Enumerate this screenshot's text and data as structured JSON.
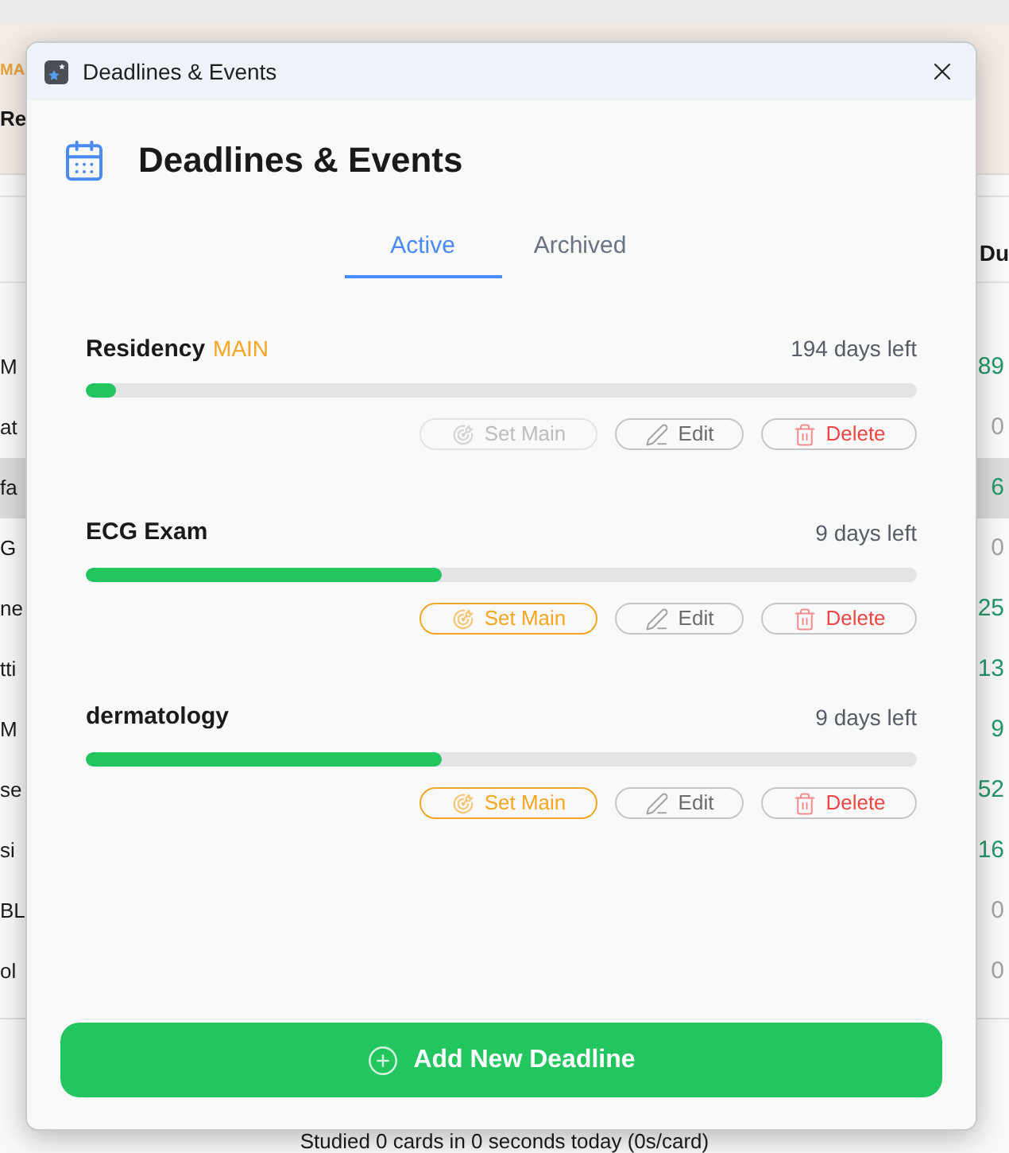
{
  "background": {
    "header_tag": "MA",
    "header_title": "Re",
    "column_header": "Du",
    "rows": [
      {
        "name": "M",
        "due": "89",
        "color": "#25966a",
        "selected": false
      },
      {
        "name": "at",
        "due": "0",
        "color": "#a3a3a3",
        "selected": false
      },
      {
        "name": "fa",
        "due": "6",
        "color": "#25966a",
        "selected": true
      },
      {
        "name": "G",
        "due": "0",
        "color": "#a3a3a3",
        "selected": false
      },
      {
        "name": "ne",
        "due": "25",
        "color": "#25966a",
        "selected": false
      },
      {
        "name": "tti",
        "due": "13",
        "color": "#25966a",
        "selected": false
      },
      {
        "name": "M",
        "due": "9",
        "color": "#25966a",
        "selected": false
      },
      {
        "name": "se",
        "due": "52",
        "color": "#25966a",
        "selected": false
      },
      {
        "name": "si",
        "due": "16",
        "color": "#25966a",
        "selected": false
      },
      {
        "name": "BL",
        "due": "0",
        "color": "#a3a3a3",
        "selected": false
      },
      {
        "name": "ol",
        "due": "0",
        "color": "#a3a3a3",
        "selected": false
      }
    ],
    "footer": "Studied 0 cards in 0 seconds today (0s/card)"
  },
  "dialog": {
    "window_title": "Deadlines & Events",
    "heading": "Deadlines & Events",
    "tabs": [
      {
        "label": "Active",
        "selected": true
      },
      {
        "label": "Archived",
        "selected": false
      }
    ],
    "deadlines": [
      {
        "title": "Residency",
        "tag": "MAIN",
        "days_left": "194 days left",
        "level": 0.036,
        "actions": [
          {
            "kind": "set_main",
            "label": "Set Main",
            "disabled": true
          },
          {
            "kind": "edit",
            "label": "Edit",
            "disabled": false
          },
          {
            "kind": "delete",
            "label": "Delete",
            "disabled": false
          }
        ]
      },
      {
        "title": "ECG Exam",
        "days_left": "9 days left",
        "level": 0.428,
        "actions": [
          {
            "kind": "set_main",
            "label": "Set Main",
            "disabled": false
          },
          {
            "kind": "edit",
            "label": "Edit",
            "disabled": false
          },
          {
            "kind": "delete",
            "label": "Delete",
            "disabled": false
          }
        ]
      },
      {
        "title": "dermatology",
        "days_left": "9 days left",
        "level": 0.428,
        "actions": [
          {
            "kind": "set_main",
            "label": "Set Main",
            "disabled": false
          },
          {
            "kind": "edit",
            "label": "Edit",
            "disabled": false
          },
          {
            "kind": "delete",
            "label": "Delete",
            "disabled": false
          }
        ]
      }
    ],
    "add_button": "Add New Deadline"
  }
}
